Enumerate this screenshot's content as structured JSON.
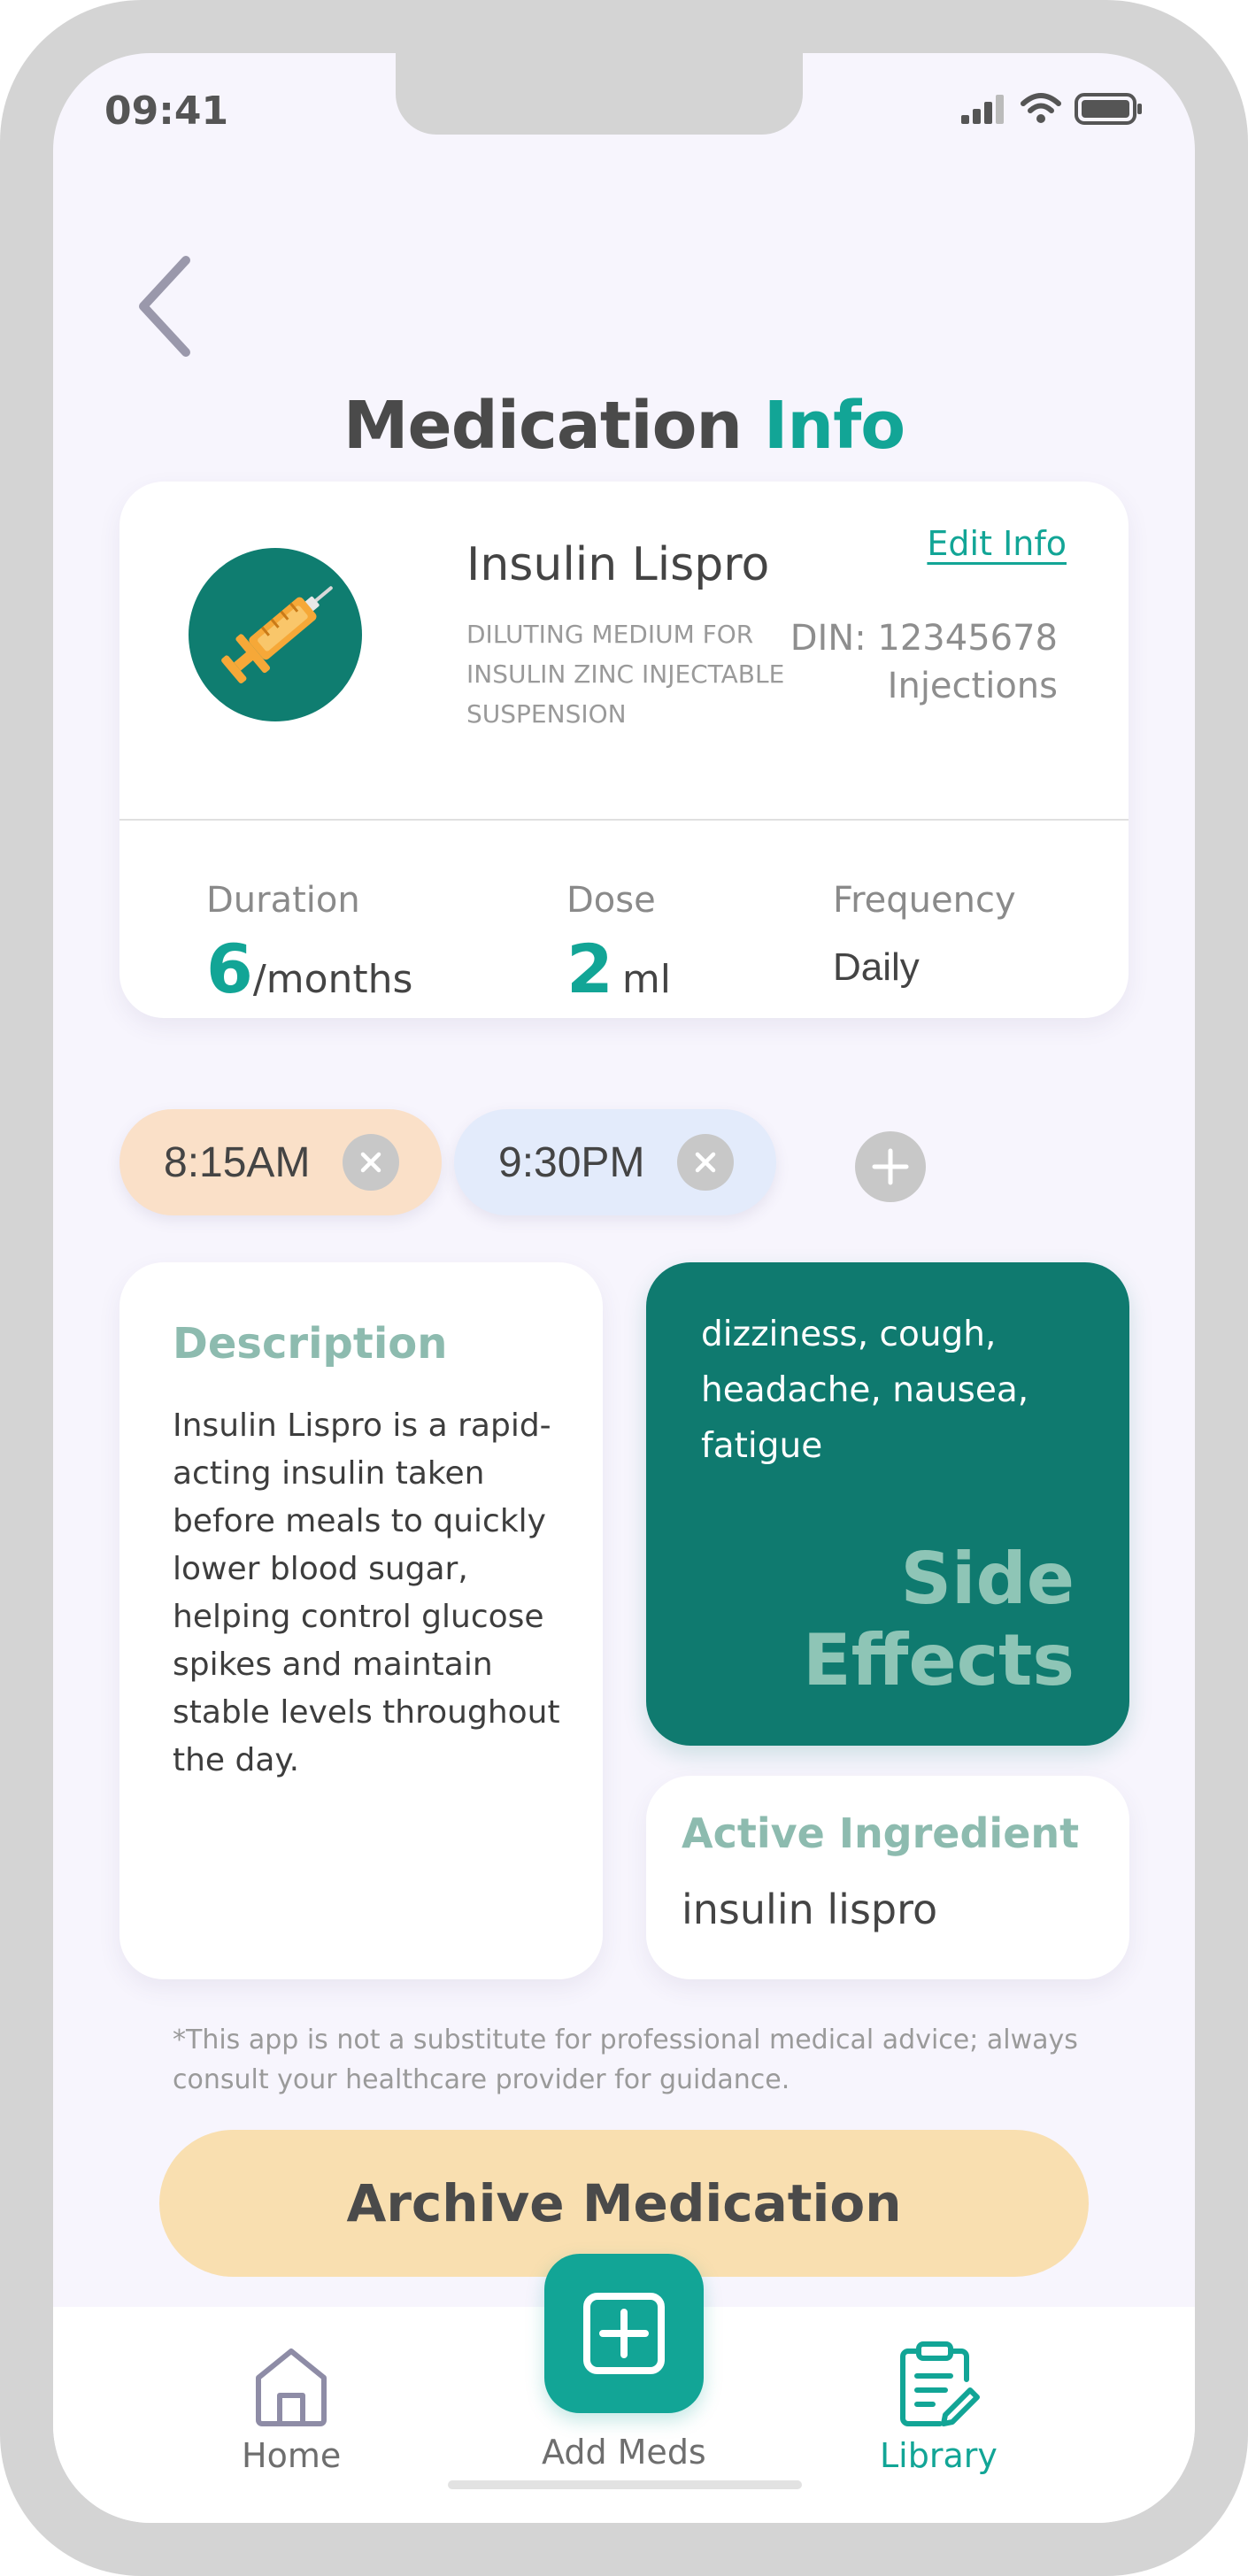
{
  "status_bar": {
    "time": "09:41"
  },
  "header": {
    "title_main": "Medication",
    "title_accent": "Info"
  },
  "medication": {
    "name": "Insulin Lispro",
    "subtitle": "DILUTING MEDIUM FOR INSULIN ZINC INJECTABLE SUSPENSION",
    "edit_label": "Edit Info",
    "din": "DIN: 12345678",
    "form": "Injections",
    "icon": "syringe-icon"
  },
  "metrics": {
    "duration": {
      "label": "Duration",
      "value": "6",
      "unit": "/months"
    },
    "dose": {
      "label": "Dose",
      "value": "2",
      "unit": "ml"
    },
    "frequency": {
      "label": "Frequency",
      "value": "Daily"
    }
  },
  "times": [
    {
      "label": "8:15AM",
      "color": "#fae0c8"
    },
    {
      "label": "9:30PM",
      "color": "#e3ebfb"
    }
  ],
  "description": {
    "title": "Description",
    "body": "Insulin Lispro is a rapid-acting insulin taken before meals to quickly lower blood sugar, helping control glucose spikes and maintain stable levels throughout the day."
  },
  "side_effects": {
    "list": "dizziness, cough, headache, nausea, fatigue",
    "title_line1": "Side",
    "title_line2": "Effects"
  },
  "active_ingredient": {
    "title": "Active Ingredient",
    "value": "insulin lispro"
  },
  "disclaimer": "*This app is not a substitute for professional medical advice; always consult your healthcare provider for guidance.",
  "archive_label": "Archive Medication",
  "tabbar": {
    "home": "Home",
    "add": "Add Meds",
    "library": "Library"
  },
  "colors": {
    "accent": "#12a596",
    "dark_teal": "#0f7a6f",
    "muted_teal": "#8dbbaf",
    "archive": "#f9dfb0",
    "background": "#f7f5fd"
  }
}
